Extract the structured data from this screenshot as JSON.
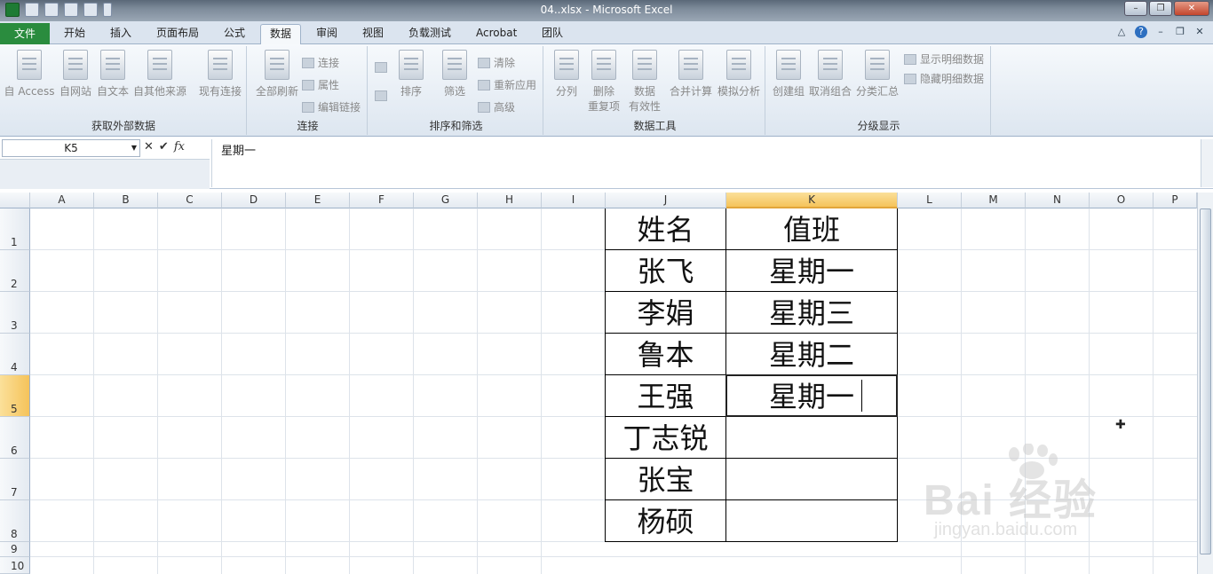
{
  "window": {
    "title": "04..xlsx - Microsoft Excel"
  },
  "ribbon": {
    "file_tab": "文件",
    "tabs": [
      "开始",
      "插入",
      "页面布局",
      "公式",
      "数据",
      "审阅",
      "视图",
      "负载测试",
      "Acrobat",
      "团队"
    ],
    "active_tab": "数据",
    "groups": {
      "external": {
        "label": "获取外部数据",
        "buttons": [
          "自 Access",
          "自网站",
          "自文本",
          "自其他来源",
          "现有连接"
        ]
      },
      "connections": {
        "label": "连接",
        "refresh_all": "全部刷新",
        "small": [
          "连接",
          "属性",
          "编辑链接"
        ]
      },
      "sort_filter": {
        "label": "排序和筛选",
        "sort": "排序",
        "filter": "筛选",
        "small": [
          "清除",
          "重新应用",
          "高级"
        ]
      },
      "data_tools": {
        "label": "数据工具",
        "split": "分列",
        "remove_dup_1": "删除",
        "remove_dup_2": "重复项",
        "validation_1": "数据",
        "validation_2": "有效性",
        "consolidate": "合并计算",
        "whatif": "模拟分析"
      },
      "outline": {
        "label": "分级显示",
        "group": "创建组",
        "ungroup": "取消组合",
        "subtotal": "分类汇总",
        "show_detail": "显示明细数据",
        "hide_detail": "隐藏明细数据"
      }
    }
  },
  "formula_bar": {
    "name_box": "K5",
    "content": "星期一",
    "fx": "fx"
  },
  "grid": {
    "columns": [
      "A",
      "B",
      "C",
      "D",
      "E",
      "F",
      "G",
      "H",
      "I",
      "J",
      "K",
      "L",
      "M",
      "N",
      "O",
      "P"
    ],
    "rows": [
      "1",
      "2",
      "3",
      "4",
      "5",
      "6",
      "7",
      "8",
      "9",
      "10"
    ],
    "selected_column": "K",
    "selected_row": "5",
    "active_cell": "K5",
    "table": [
      {
        "name": "姓名",
        "duty": "值班"
      },
      {
        "name": "张飞",
        "duty": "星期一"
      },
      {
        "name": "李娟",
        "duty": "星期三"
      },
      {
        "name": "鲁本",
        "duty": "星期二"
      },
      {
        "name": "王强",
        "duty": "星期一"
      },
      {
        "name": "丁志锐",
        "duty": ""
      },
      {
        "name": "张宝",
        "duty": ""
      },
      {
        "name": "杨硕",
        "duty": ""
      }
    ]
  },
  "watermark": {
    "main": "Bai 经验",
    "sub": "jingyan.baidu.com"
  }
}
